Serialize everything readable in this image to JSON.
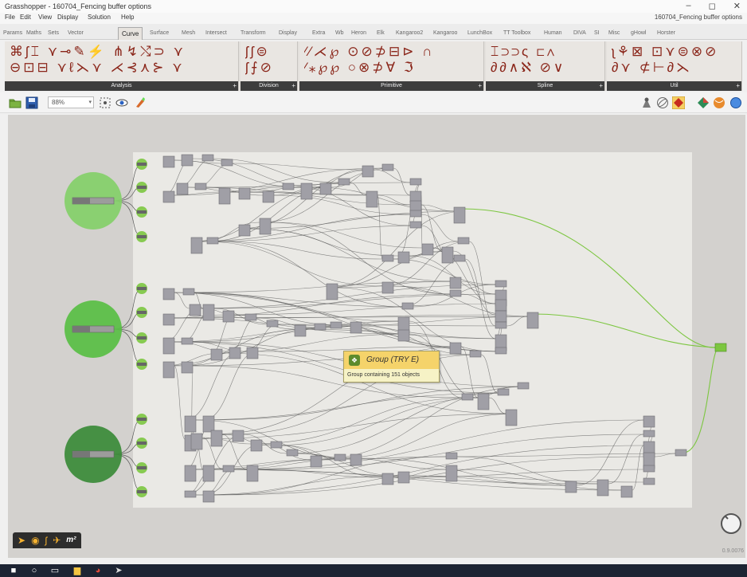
{
  "window": {
    "title": "Grasshopper - 160704_Fencing buffer options",
    "document": "160704_Fencing buffer options",
    "controls": [
      "–",
      "◻",
      "✕"
    ]
  },
  "menu": [
    "File",
    "Edit",
    "View",
    "Display",
    "Solution",
    "Help"
  ],
  "tabs": [
    {
      "label": "Params",
      "active": false
    },
    {
      "label": "Maths",
      "active": false
    },
    {
      "label": "Sets",
      "active": false
    },
    {
      "label": "Vector",
      "active": false
    },
    {
      "label": "Curve",
      "active": true
    },
    {
      "label": "Surface",
      "active": false
    },
    {
      "label": "Mesh",
      "active": false
    },
    {
      "label": "Intersect",
      "active": false
    },
    {
      "label": "Transform",
      "active": false
    },
    {
      "label": "Display",
      "active": false
    },
    {
      "label": "Extra",
      "active": false
    },
    {
      "label": "Wb",
      "active": false
    },
    {
      "label": "Heron",
      "active": false
    },
    {
      "label": "Elk",
      "active": false
    },
    {
      "label": "Kangaroo2",
      "active": false
    },
    {
      "label": "Kangaroo",
      "active": false
    },
    {
      "label": "LunchBox",
      "active": false
    },
    {
      "label": "TT Toolbox",
      "active": false
    },
    {
      "label": "Human",
      "active": false
    },
    {
      "label": "DIVA",
      "active": false
    },
    {
      "label": "SI",
      "active": false
    },
    {
      "label": "Misc",
      "active": false
    },
    {
      "label": "gHowl",
      "active": false
    },
    {
      "label": "Horster",
      "active": false
    }
  ],
  "ribbon_groups": [
    {
      "label": "Analysis",
      "icon_color": "#8a2519"
    },
    {
      "label": "Division",
      "icon_color": "#8a2519"
    },
    {
      "label": "Primitive",
      "icon_color": "#8a2519"
    },
    {
      "label": "Spline",
      "icon_color": "#8a2519"
    },
    {
      "label": "Util",
      "icon_color": "#8a2519"
    }
  ],
  "canvas_toolbar": {
    "zoom": "88%",
    "icons": [
      "open-file-icon",
      "save-file-icon",
      "sketch-icon",
      "preview-icon",
      "paint-icon",
      "shaded-icon",
      "wireframe-icon",
      "selected-preview-icon",
      "mesh-icon",
      "sphere-icon"
    ]
  },
  "canvas": {
    "background": "#d3d1ce",
    "group_fill": "#eae9e5",
    "slider_colors": [
      "#86d06c",
      "#5cbf48",
      "#3e8c3c"
    ],
    "component_color": "#a09fa6",
    "output_color": "#7cc640"
  },
  "tooltip": {
    "title": "Group (TRY E)",
    "description": "Group containing 151 objects"
  },
  "status": {
    "version": "0.9.0076",
    "icons": [
      "grasshopper-icon",
      "mushroom-icon",
      "pencil-icon",
      "bird-icon",
      "m²"
    ]
  },
  "taskbar": {
    "background": "#1d2433",
    "items": [
      "windows-start-icon",
      "search-icon",
      "task-view-icon",
      "file-explorer-icon",
      "chrome-icon",
      "grasshopper-icon"
    ]
  }
}
